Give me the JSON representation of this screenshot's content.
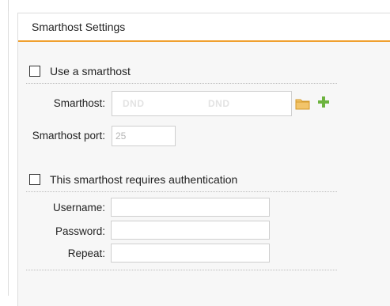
{
  "panel": {
    "title": "Smarthost Settings"
  },
  "smarthost": {
    "use_label": "Use a smarthost",
    "use_checked": false,
    "host_label": "Smarthost:",
    "dnd_left": "DND",
    "dnd_right": "DND",
    "port_label": "Smarthost port:",
    "port_value": "25"
  },
  "auth": {
    "requires_label": "This smarthost requires authentication",
    "requires_checked": false,
    "username_label": "Username:",
    "username_value": "",
    "password_label": "Password:",
    "password_value": "",
    "repeat_label": "Repeat:",
    "repeat_value": ""
  },
  "icons": {
    "folder": "folder-icon",
    "add": "plus-icon"
  },
  "colors": {
    "accent": "#f0a030",
    "folder": "#f2c46a",
    "add": "#6db33f"
  }
}
